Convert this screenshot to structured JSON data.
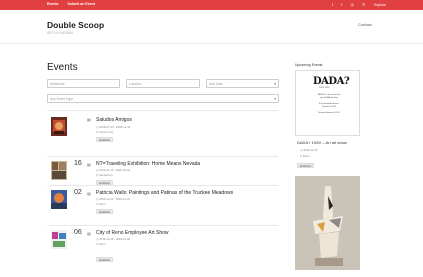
{
  "topbar": {
    "nav_items": [
      "Events",
      "Submit an Event"
    ],
    "explore_label": "Explore",
    "social_icons": [
      "twitter-icon",
      "facebook-icon",
      "instagram-icon",
      "search-icon"
    ],
    "color": "#e04040"
  },
  "site": {
    "title": "Double Scoop",
    "tagline": "ARTS IN NEVADA",
    "contact": "Contact"
  },
  "main": {
    "heading": "Events",
    "filters": {
      "keywords_placeholder": "Keywords",
      "location_placeholder": "Location",
      "date_value": "Any Date",
      "event_type_value": "Any Event Type"
    },
    "events": [
      {
        "day": "",
        "title": "Saludos Amigos",
        "date": "2018-07-03 - 2018-12-31",
        "location": "Carson City",
        "tag": "Exhibition"
      },
      {
        "day": "16",
        "title": "NT=Traveling Exhibition: Home Means Nevada",
        "date": "2019-11-16 - 2020-01-04",
        "location": "Henderson",
        "tag": "Exhibition"
      },
      {
        "day": "02",
        "title": "Patricia Walls: Paintings and Patinas of the Truckee Meadows",
        "date": "2019-11-02 - 2019-12-31",
        "location": "Reno",
        "tag": "Exhibition"
      },
      {
        "day": "06",
        "title": "City of Reno Employee Art Show",
        "date": "2019-11-06 - 2019-12-06",
        "location": "Reno",
        "tag": "Exhibition"
      }
    ]
  },
  "sidebar": {
    "heading": "Upcoming Events",
    "poster": {
      "logo": "DADA?",
      "sub": "1919-1920",
      "lines": [
        "DADA 1919... An art show at the",
        "spirit of DADA and antiart",
        "",
        "At The Nevada Art Museum",
        "November 16, 2019",
        "",
        "Reception November 16, 2019"
      ]
    },
    "event": {
      "title": "DADA? 1920! – An art show",
      "date": "2019-11-23",
      "location": "Reno",
      "tag": "Exhibition"
    }
  }
}
